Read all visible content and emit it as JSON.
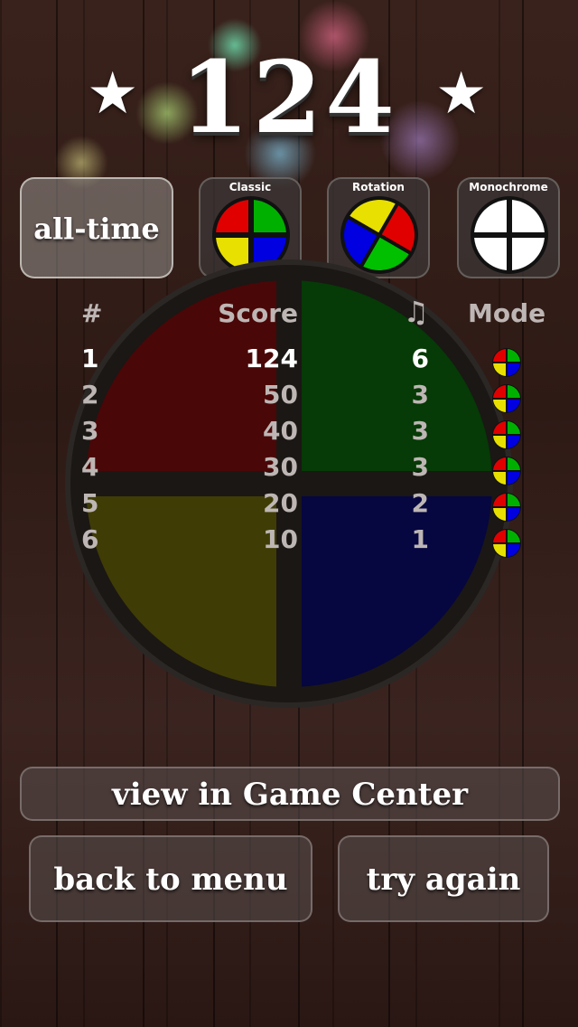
{
  "score": "124",
  "left_star": "★",
  "right_star": "★",
  "filter_button": "all-time",
  "modes": [
    {
      "label": "Classic",
      "icon": "classic-mode-icon"
    },
    {
      "label": "Rotation",
      "icon": "rotation-mode-icon"
    },
    {
      "label": "Monochrome",
      "icon": "monochrome-mode-icon"
    }
  ],
  "table": {
    "headers": {
      "rank": "#",
      "score": "Score",
      "notes": "♫",
      "mode": "Mode"
    },
    "rows": [
      {
        "rank": "1",
        "score": "124",
        "notes": "6",
        "mode_icon": "classic-mode-icon",
        "highlight": true
      },
      {
        "rank": "2",
        "score": "50",
        "notes": "3",
        "mode_icon": "classic-mode-icon"
      },
      {
        "rank": "3",
        "score": "40",
        "notes": "3",
        "mode_icon": "classic-mode-icon"
      },
      {
        "rank": "4",
        "score": "30",
        "notes": "3",
        "mode_icon": "classic-mode-icon"
      },
      {
        "rank": "5",
        "score": "20",
        "notes": "2",
        "mode_icon": "classic-mode-icon"
      },
      {
        "rank": "6",
        "score": "10",
        "notes": "1",
        "mode_icon": "classic-mode-icon"
      }
    ]
  },
  "buttons": {
    "game_center": "view in Game Center",
    "back": "back to menu",
    "retry": "try again"
  },
  "colors": {
    "red": "#e00000",
    "green": "#00b000",
    "blue": "#0000e0",
    "yellow": "#e8e000"
  }
}
